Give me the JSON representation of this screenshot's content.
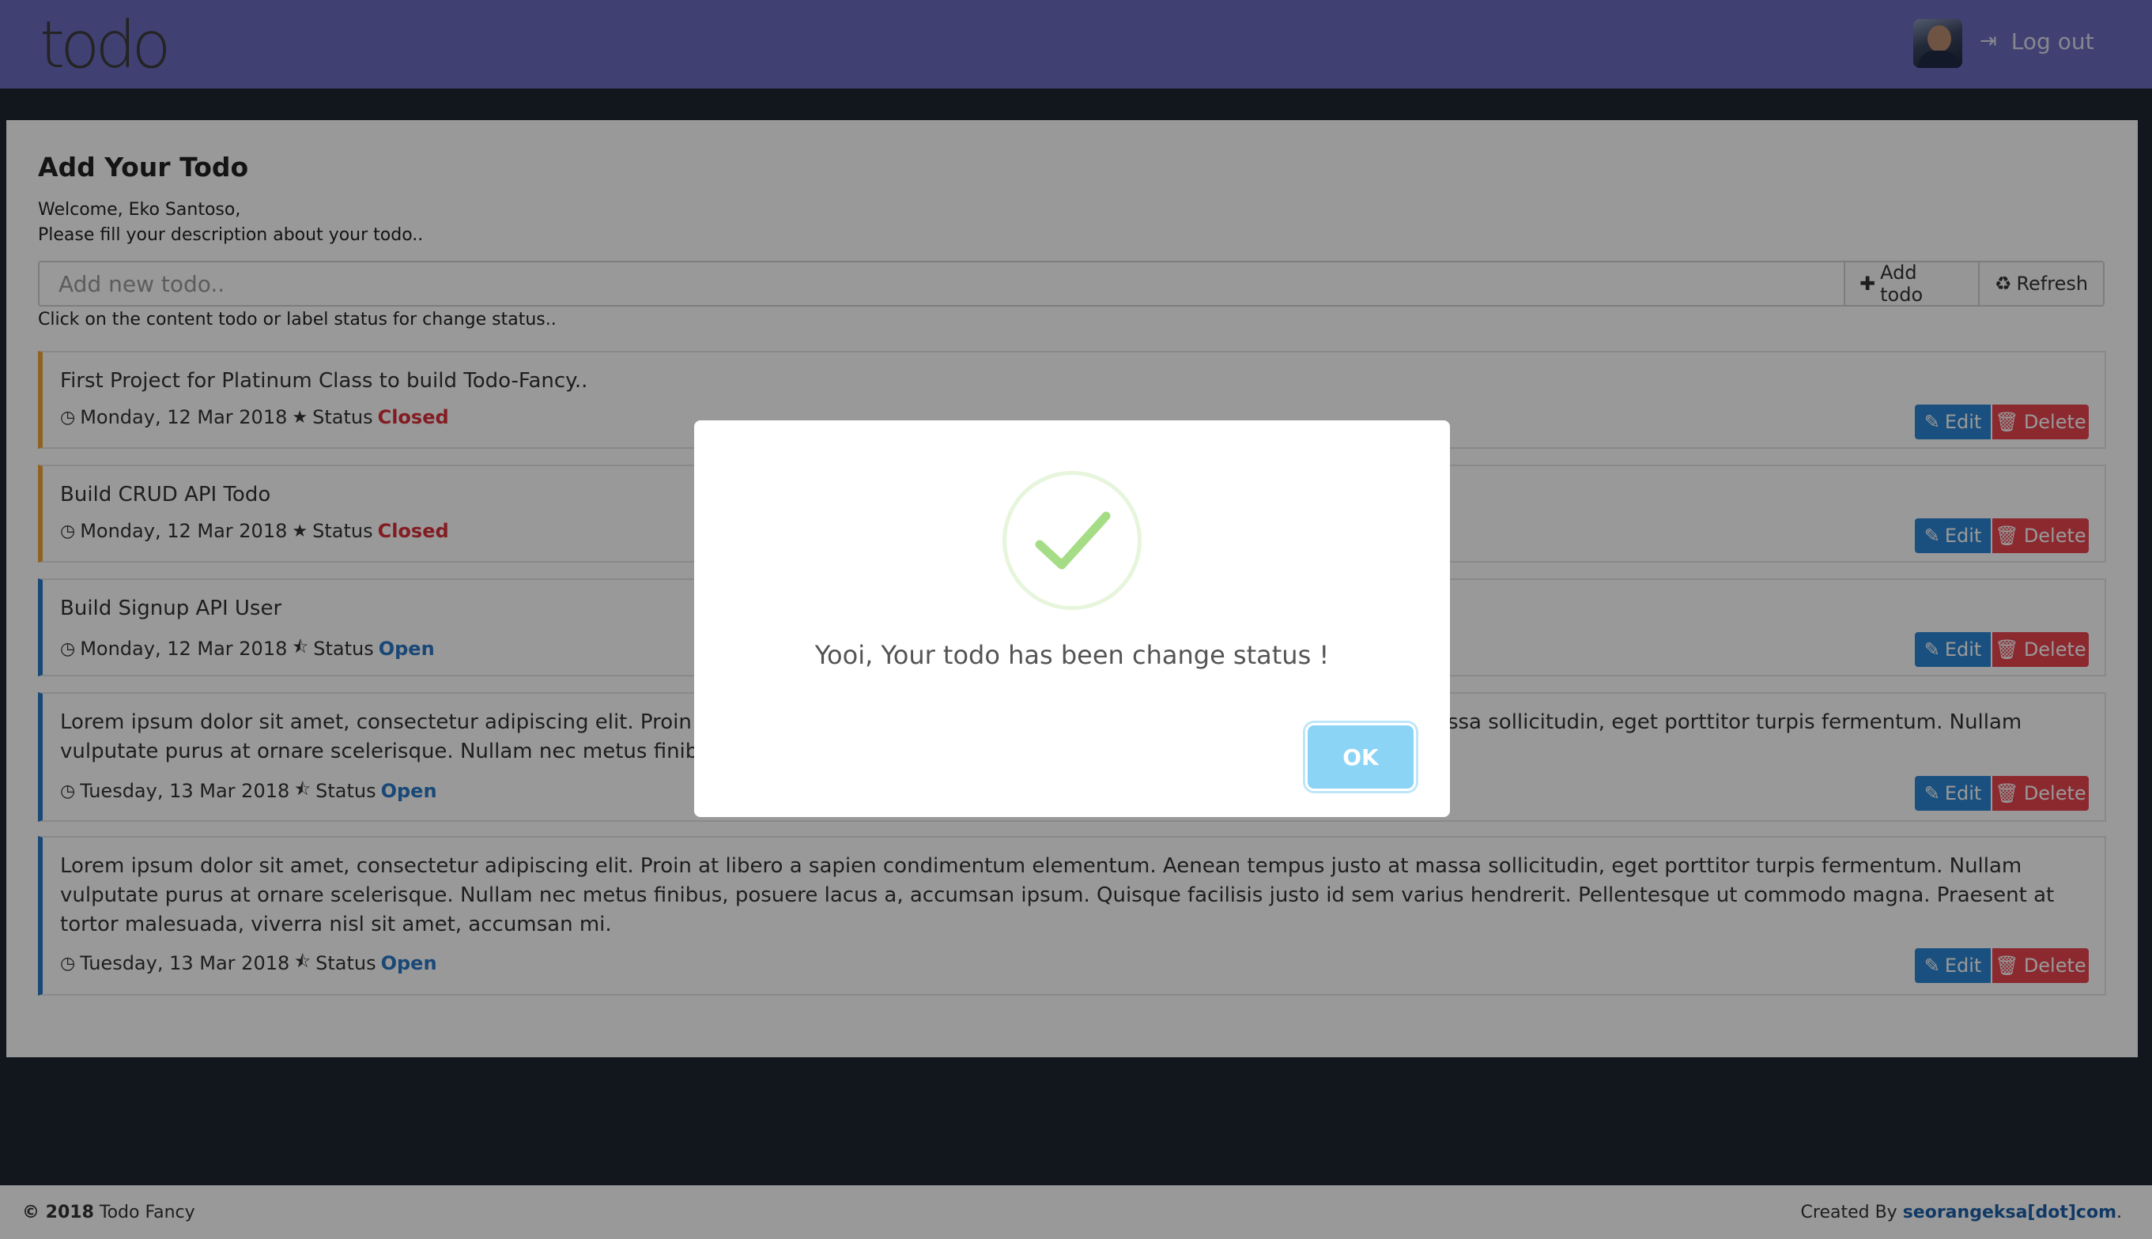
{
  "navbar": {
    "brand": "todo",
    "logout_label": "Log out",
    "background_color": "#6b6bc0"
  },
  "main": {
    "title": "Add Your Todo",
    "welcome_line1": "Welcome, Eko Santoso,",
    "welcome_line2": "Please fill your description about your todo..",
    "input_placeholder": "Add new todo..",
    "add_button_label": "Add todo",
    "refresh_button_label": "Refresh",
    "hint": "Click on the content todo or label status for change status..",
    "status_prefix": "Status",
    "edit_label": "Edit",
    "delete_label": "Delete",
    "todos": [
      {
        "text": "First Project for Platinum Class to build Todo-Fancy..",
        "date": "Monday, 12 Mar 2018",
        "status": "Closed",
        "status_color": "#d9303a",
        "status_icon": "star-icon"
      },
      {
        "text": "Build CRUD API Todo",
        "date": "Monday, 12 Mar 2018",
        "status": "Closed",
        "status_color": "#d9303a",
        "status_icon": "star-icon"
      },
      {
        "text": "Build Signup API User",
        "date": "Monday, 12 Mar 2018",
        "status": "Open",
        "status_color": "#2a79c7",
        "status_icon": "half-star-icon"
      },
      {
        "text": "Lorem ipsum dolor sit amet, consectetur adipiscing elit. Proin at libero a sapien condimentum elementum. Aenean tempus justo at massa sollicitudin, eget porttitor turpis fermentum. Nullam vulputate purus at ornare scelerisque. Nullam nec metus finibus, posuere lacus a, accumsan ipsum.",
        "date": "Tuesday, 13 Mar 2018",
        "status": "Open",
        "status_color": "#2a79c7",
        "status_icon": "half-star-icon"
      },
      {
        "text": "Lorem ipsum dolor sit amet, consectetur adipiscing elit. Proin at libero a sapien condimentum elementum. Aenean tempus justo at massa sollicitudin, eget porttitor turpis fermentum. Nullam vulputate purus at ornare scelerisque. Nullam nec metus finibus, posuere lacus a, accumsan ipsum. Quisque facilisis justo id sem varius hendrerit. Pellentesque ut commodo magna. Praesent at tortor malesuada, viverra nisl sit amet, accumsan mi.",
        "date": "Tuesday, 13 Mar 2018",
        "status": "Open",
        "status_color": "#2a79c7",
        "status_icon": "half-star-icon"
      }
    ]
  },
  "footer": {
    "copyright_year": "© 2018",
    "app_name": "Todo Fancy",
    "created_by_prefix": "Created By",
    "created_by_link": "seorangeksa[dot]com",
    "created_by_suffix": "."
  },
  "modal": {
    "message": "Yooi, Your todo has been change status !",
    "ok_label": "OK",
    "icon": "success-checkmark-icon",
    "ok_color": "#8cd4f5"
  }
}
